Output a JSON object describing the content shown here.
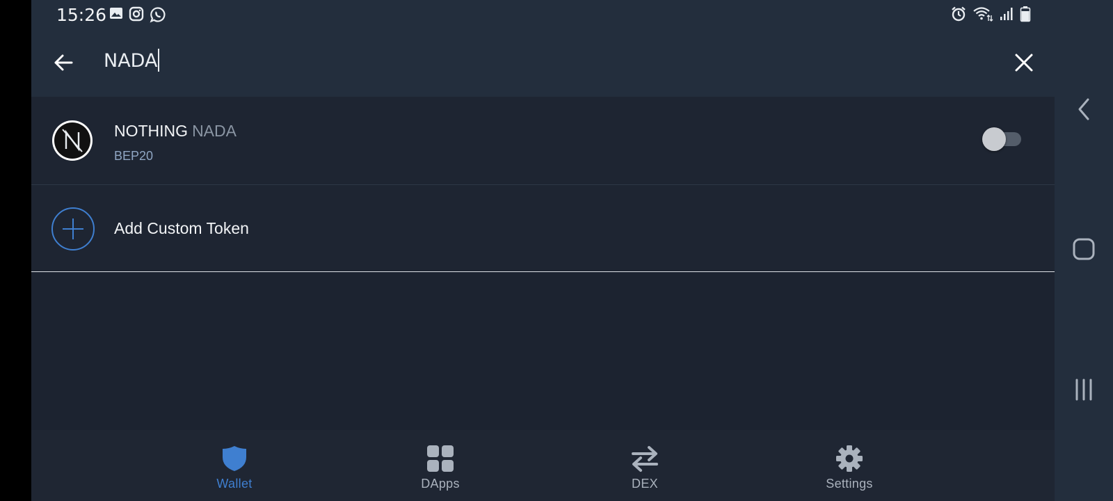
{
  "status_bar": {
    "time": "15:26",
    "left_icons": [
      "gallery-icon",
      "instagram-icon",
      "whatsapp-icon"
    ],
    "right_icons": [
      "alarm-icon",
      "wifi-icon",
      "signal-icon",
      "battery-icon"
    ]
  },
  "search": {
    "query": "NADA",
    "back_icon": "arrow-left-icon",
    "clear_icon": "close-icon"
  },
  "token": {
    "name": "NOTHING",
    "symbol": "NADA",
    "network": "BEP20",
    "enabled": false,
    "logo_letter": "N"
  },
  "add_custom": {
    "label": "Add Custom Token",
    "icon": "plus-circle-icon"
  },
  "bottom_nav": {
    "items": [
      {
        "label": "Wallet",
        "icon": "shield-icon",
        "active": true
      },
      {
        "label": "DApps",
        "icon": "grid-icon",
        "active": false
      },
      {
        "label": "DEX",
        "icon": "swap-arrows-icon",
        "active": false
      },
      {
        "label": "Settings",
        "icon": "gear-icon",
        "active": false
      }
    ]
  },
  "colors": {
    "background": "#1c2330",
    "header": "#232e3d",
    "accent": "#3f7fd0",
    "text": "#f2f4f6",
    "muted": "#8a95a3"
  },
  "system_nav": [
    "back-icon",
    "home-icon",
    "recents-icon"
  ]
}
